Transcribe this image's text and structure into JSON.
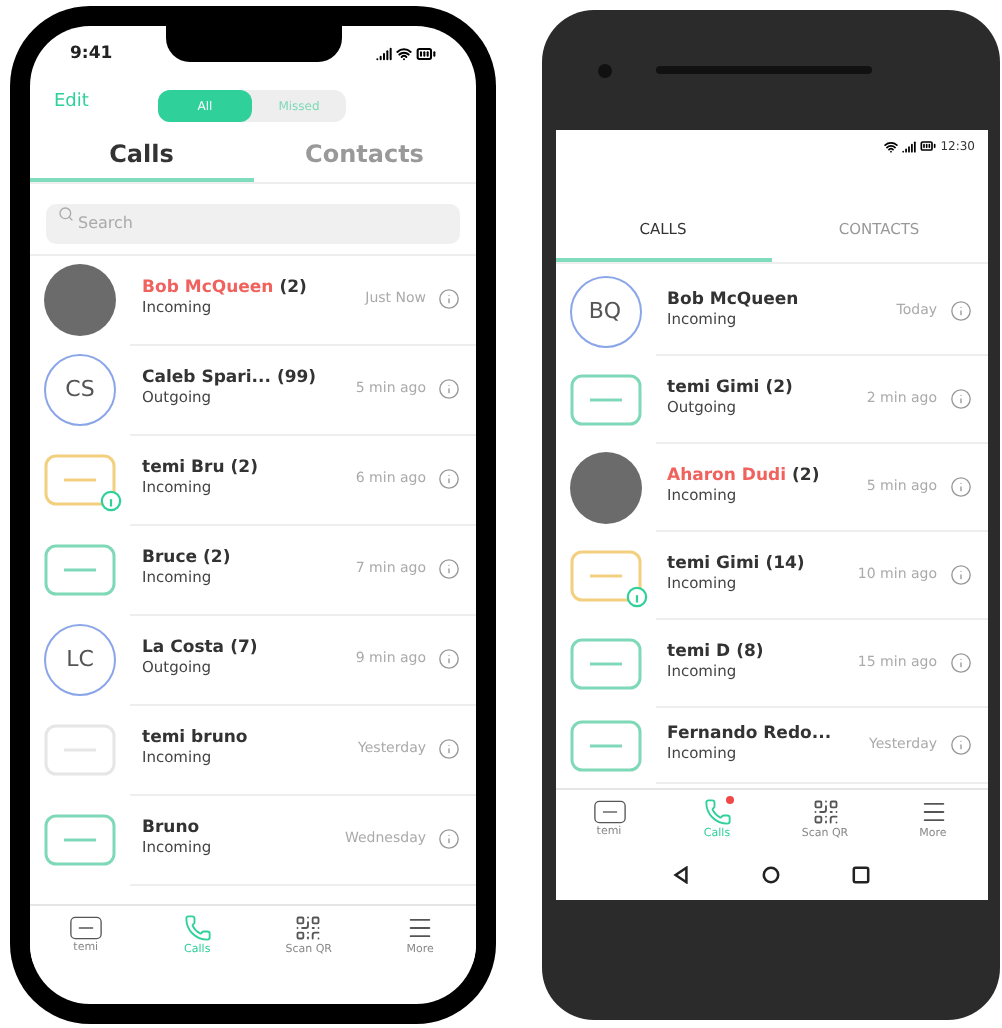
{
  "phones": [
    {
      "kind": "ios",
      "status_time": "9:41",
      "edit": "Edit",
      "filter": [
        {
          "label": "All",
          "selected": true
        },
        {
          "label": "Missed",
          "selected": false
        }
      ],
      "tabs": [
        {
          "label": "Calls",
          "selected": true
        },
        {
          "label": "Contacts",
          "selected": false
        }
      ],
      "search": {
        "placeholder": "Search"
      },
      "calls": [
        {
          "name": "Bob McQueen",
          "count": "(2)",
          "missed": true,
          "direction": "Incoming",
          "time": "Just Now",
          "avatar": {
            "kind": "photo"
          }
        },
        {
          "name": "Caleb Spari...",
          "count": "(99)",
          "missed": false,
          "direction": "Outgoing",
          "time": "5 min ago",
          "avatar": {
            "kind": "initials",
            "text": "CS"
          }
        },
        {
          "name": "temi Bru",
          "count": "(2)",
          "missed": false,
          "direction": "Incoming",
          "time": "6 min ago",
          "avatar": {
            "kind": "device",
            "color": "#f2d07e",
            "badge": true
          }
        },
        {
          "name": "Bruce",
          "count": "(2)",
          "missed": false,
          "direction": "Incoming",
          "time": "7 min ago",
          "avatar": {
            "kind": "device",
            "color": "#7fd9b8",
            "badge": false
          }
        },
        {
          "name": "La Costa",
          "count": "(7)",
          "missed": false,
          "direction": "Outgoing",
          "time": "9 min ago",
          "avatar": {
            "kind": "initials",
            "text": "LC"
          }
        },
        {
          "name": "temi bruno",
          "missed": false,
          "direction": "Incoming",
          "time": "Yesterday",
          "avatar": {
            "kind": "device",
            "color": "#e6e6e6",
            "badge": false
          }
        },
        {
          "name": "Bruno",
          "missed": false,
          "direction": "Incoming",
          "time": "Wednesday",
          "avatar": {
            "kind": "device",
            "color": "#7fd9b8",
            "badge": false
          }
        }
      ],
      "nav": [
        {
          "kind": "device",
          "label": "temi",
          "selected": false,
          "badge": false
        },
        {
          "kind": "phone",
          "label": "Calls",
          "selected": true,
          "badge": false
        },
        {
          "kind": "qr",
          "label": "Scan QR",
          "selected": false,
          "badge": false
        },
        {
          "kind": "menu",
          "label": "More",
          "selected": false,
          "badge": false
        }
      ]
    },
    {
      "kind": "android",
      "status_time": "12:30",
      "tabs": [
        {
          "label": "CALLS",
          "selected": true
        },
        {
          "label": "CONTACTS",
          "selected": false
        }
      ],
      "calls": [
        {
          "name": "Bob McQueen",
          "missed": false,
          "direction": "Incoming",
          "time": "Today",
          "avatar": {
            "kind": "initials",
            "text": "BQ"
          }
        },
        {
          "name": "temi Gimi",
          "count": "(2)",
          "missed": false,
          "direction": "Outgoing",
          "time": "2 min ago",
          "avatar": {
            "kind": "device",
            "color": "#7fd9b8",
            "badge": false
          }
        },
        {
          "name": "Aharon Dudi",
          "count": "(2)",
          "missed": true,
          "direction": "Incoming",
          "time": "5 min ago",
          "avatar": {
            "kind": "photo"
          }
        },
        {
          "name": "temi Gimi",
          "count": "(14)",
          "missed": false,
          "direction": "Incoming",
          "time": "10 min ago",
          "avatar": {
            "kind": "device",
            "color": "#f2d07e",
            "badge": true
          }
        },
        {
          "name": "temi D",
          "count": "(8)",
          "missed": false,
          "direction": "Incoming",
          "time": "15 min ago",
          "avatar": {
            "kind": "device",
            "color": "#7fd9b8",
            "badge": false
          }
        },
        {
          "name": "Fernando Redo...",
          "missed": false,
          "direction": "Incoming",
          "time": "Yesterday",
          "avatar": {
            "kind": "device",
            "color": "#7fd9b8",
            "badge": false
          }
        }
      ],
      "nav": [
        {
          "kind": "device",
          "label": "temi",
          "selected": false,
          "badge": false
        },
        {
          "kind": "phone",
          "label": "Calls",
          "selected": true,
          "badge": true
        },
        {
          "kind": "qr",
          "label": "Scan QR",
          "selected": false,
          "badge": false
        },
        {
          "kind": "menu",
          "label": "More",
          "selected": false,
          "badge": false
        }
      ]
    }
  ]
}
